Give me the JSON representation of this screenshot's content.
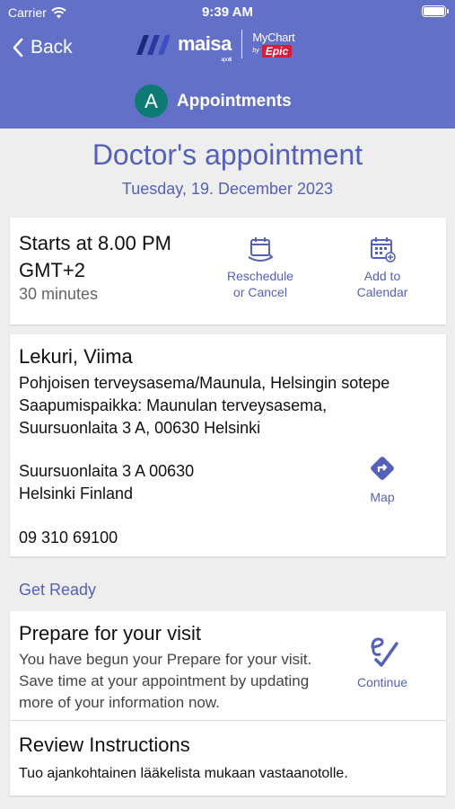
{
  "status_bar": {
    "carrier": "Carrier",
    "time": "9:39 AM"
  },
  "nav": {
    "back_label": "Back"
  },
  "branding": {
    "maisa": "maisa",
    "maisa_sub": "apotti",
    "mychart": "MyChart",
    "mychart_by": "by",
    "epic": "Epic"
  },
  "patient": {
    "initial": "A",
    "section": "Appointments"
  },
  "page": {
    "title": "Doctor's appointment",
    "date": "Tuesday, 19. December 2023"
  },
  "time_card": {
    "starts": "Starts at 8.00 PM GMT+2",
    "duration": "30 minutes",
    "reschedule_line1": "Reschedule",
    "reschedule_line2": "or Cancel",
    "calendar_line1": "Add to",
    "calendar_line2": "Calendar"
  },
  "location_card": {
    "provider": "Lekuri, Viima",
    "department": "Pohjoisen terveysasema/Maunula, Helsingin sotepe",
    "arrival_line1": "Saapumispaikka: Maunulan terveysasema,",
    "arrival_line2": "Suursuonlaita 3 A, 00630 Helsinki",
    "address_line1": "Suursuonlaita 3 A 00630",
    "address_line2": "Helsinki Finland",
    "phone": "09 310 69100",
    "map_label": "Map"
  },
  "get_ready": {
    "section_title": "Get Ready",
    "prepare_title": "Prepare for your visit",
    "prepare_body": "You have begun your Prepare for your visit. Save time at your appointment by updating more of your information now.",
    "continue_label": "Continue",
    "review_title": "Review Instructions",
    "review_body": "Tuo ajankohtainen lääkelista mukaan vastaanotolle."
  },
  "colors": {
    "header_bg": "#6370c8",
    "accent": "#5561b8",
    "avatar": "#0f7a73",
    "epic": "#d21f3c"
  },
  "icons": [
    "wifi-icon",
    "battery-icon",
    "chevron-left-icon",
    "maisa-logo-icon",
    "reschedule-calendar-icon",
    "add-calendar-icon",
    "map-direction-icon",
    "checkin-icon"
  ]
}
